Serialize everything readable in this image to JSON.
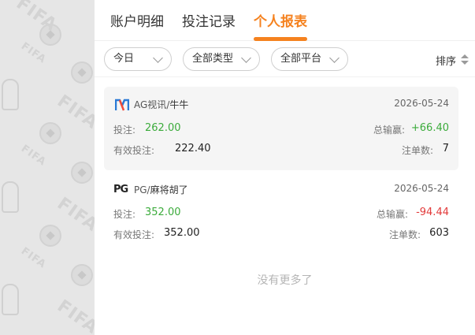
{
  "tabs": [
    {
      "label": "账户明细"
    },
    {
      "label": "投注记录"
    },
    {
      "label": "个人报表"
    }
  ],
  "active_tab": "个人报表",
  "filters": {
    "date": "今日",
    "type": "全部类型",
    "platform": "全部平台",
    "sort": "排序"
  },
  "records": [
    {
      "vendor": "AG视讯",
      "separator": "/",
      "game": "牛牛",
      "date": "2026-05-24",
      "bet_label": "投注:",
      "bet": "262.00",
      "valid_label": "有效投注:",
      "valid": "222.40",
      "winloss_label": "总输赢:",
      "winloss": "+66.40",
      "count_label": "注单数:",
      "count": "7"
    },
    {
      "vendor": "PG",
      "separator": "/",
      "game": "麻将胡了",
      "date": "2026-05-24",
      "bet_label": "投注:",
      "bet": "352.00",
      "valid_label": "有效投注:",
      "valid": "352.00",
      "winloss_label": "总输赢:",
      "winloss": "-94.44",
      "count_label": "注单数:",
      "count": "603"
    }
  ],
  "footer": {
    "no_more": "没有更多了"
  },
  "colors": {
    "accent": "#f5821f",
    "win": "#3bab3b",
    "loss": "#e23a3a"
  },
  "icons": {
    "ag_logo": "ag-logo-icon",
    "pg_logo": "pg-logo-icon"
  }
}
